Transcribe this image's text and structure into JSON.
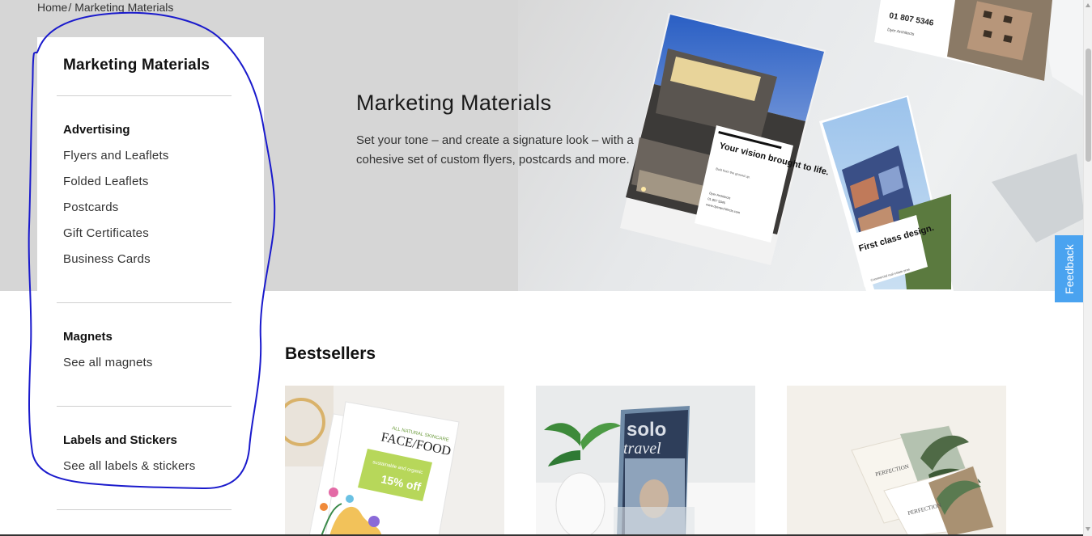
{
  "breadcrumb": {
    "home": "Home",
    "separator": "/",
    "current": "Marketing Materials"
  },
  "sidebar": {
    "title": "Marketing Materials",
    "sections": [
      {
        "heading": "Advertising",
        "links": [
          "Flyers and Leaflets",
          "Folded Leaflets",
          "Postcards",
          "Gift Certificates",
          "Business Cards"
        ]
      },
      {
        "heading": "Magnets",
        "links": [
          "See all magnets"
        ]
      },
      {
        "heading": "Labels and Stickers",
        "links": [
          "See all labels & stickers"
        ]
      }
    ]
  },
  "hero": {
    "title": "Marketing Materials",
    "description": "Set your tone – and create a signature look – with a cohesive set of custom flyers, postcards and more.",
    "brochure1": {
      "heading": "Your vision brought to life.",
      "sub": "Built from the ground up.",
      "company": "Dyer Architects",
      "phone": "01 807 5346",
      "web": "www.dyerarchitects.com"
    },
    "brochure2": {
      "heading": "First class design.",
      "sub": "Commercial real estate pros"
    },
    "card_top": {
      "phone": "01 807 5346",
      "company": "Dyer Architects"
    }
  },
  "bestsellers": {
    "title": "Bestsellers",
    "cards": [
      {
        "label1": "ALL NATURAL SKINCARE",
        "label2": "FACE/FOOD",
        "label3": "sustainable and organic",
        "label4": "15% off"
      },
      {
        "label1": "solo",
        "label2": "travel"
      },
      {
        "label1": "PERFECTION",
        "label2": "PERFECTION"
      }
    ]
  },
  "feedback": {
    "label": "Feedback"
  },
  "colors": {
    "annotation": "#1a1acc",
    "feedback": "#4aa3f0",
    "flyer_accent": "#b7d75a"
  }
}
